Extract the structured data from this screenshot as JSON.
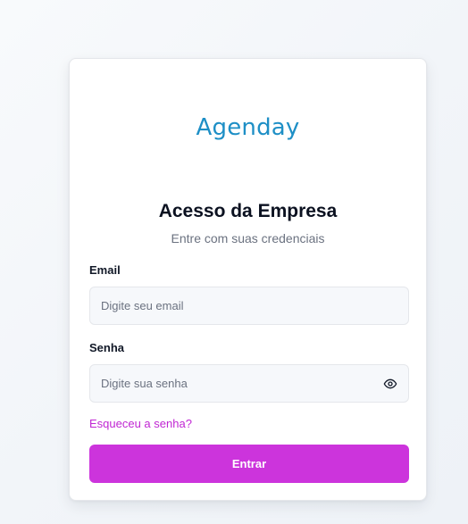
{
  "brand": {
    "logo_text": "Agenday",
    "logo_color": "#1e8fc6",
    "accent_color": "#cc34dc"
  },
  "login": {
    "title": "Acesso da Empresa",
    "subtitle": "Entre com suas credenciais",
    "email": {
      "label": "Email",
      "placeholder": "Digite seu email",
      "value": ""
    },
    "password": {
      "label": "Senha",
      "placeholder": "Digite sua senha",
      "value": "",
      "toggle_icon": "eye-icon"
    },
    "forgot_link": "Esqueceu a senha?",
    "submit_label": "Entrar"
  }
}
